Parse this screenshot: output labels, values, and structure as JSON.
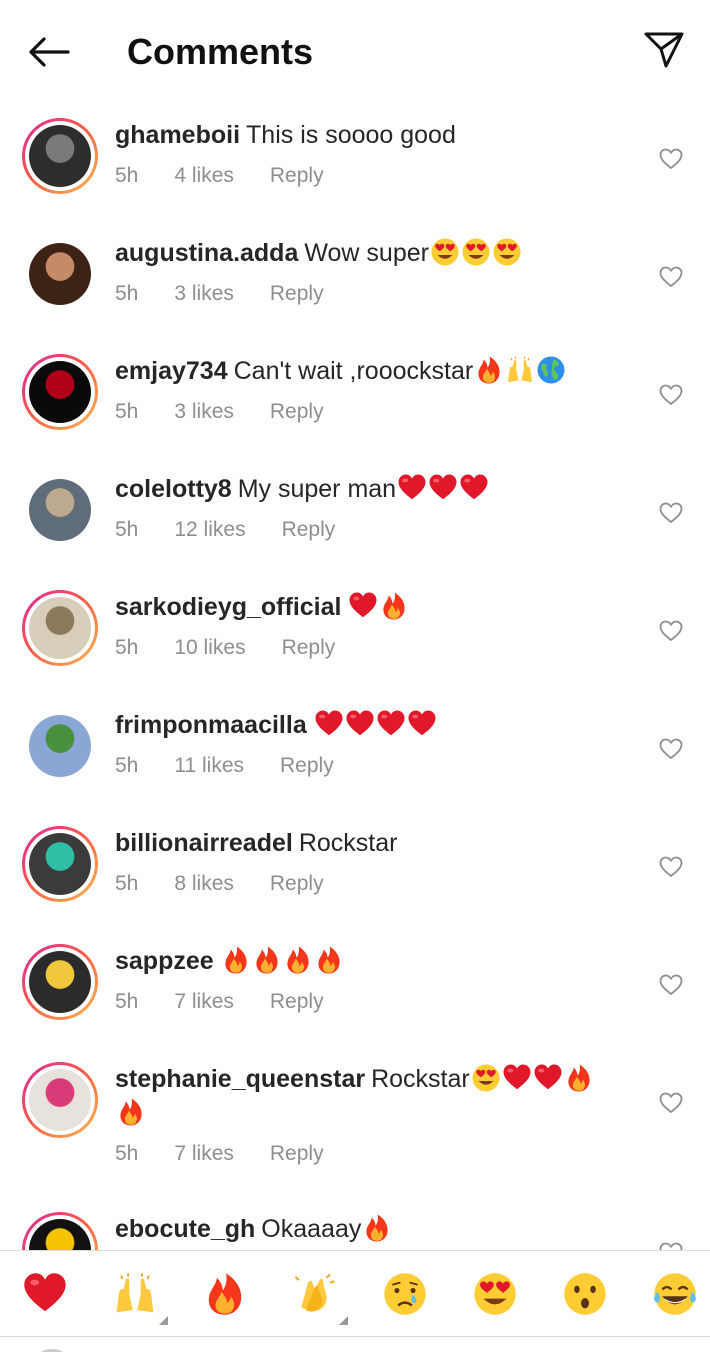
{
  "header": {
    "title": "Comments",
    "back_icon": "arrow-left-icon",
    "send_icon": "paper-plane-icon"
  },
  "colors": {
    "story_ring_start": "#d6249f",
    "story_ring_end": "#fdbb4f",
    "meta_gray": "#8e8e8e",
    "text": "#262626"
  },
  "comments": [
    {
      "username": "ghameboii",
      "text": "This is soooo good",
      "emojis": [],
      "time": "5h",
      "likes": "4 likes",
      "reply": "Reply",
      "story_ring": true
    },
    {
      "username": "augustina.adda",
      "text": "Wow super",
      "emojis": [
        "heart-eyes",
        "heart-eyes",
        "heart-eyes"
      ],
      "time": "5h",
      "likes": "3 likes",
      "reply": "Reply",
      "story_ring": false
    },
    {
      "username": "emjay734",
      "text": "Can't wait ,rooockstar",
      "emojis": [
        "fire",
        "raising-hands",
        "globe"
      ],
      "time": "5h",
      "likes": "3 likes",
      "reply": "Reply",
      "story_ring": true
    },
    {
      "username": "colelotty8",
      "text": "My super man",
      "emojis": [
        "red-heart",
        "red-heart",
        "red-heart"
      ],
      "time": "5h",
      "likes": "12 likes",
      "reply": "Reply",
      "story_ring": false
    },
    {
      "username": "sarkodieyg_official",
      "text": "",
      "emojis": [
        "red-heart",
        "fire"
      ],
      "time": "5h",
      "likes": "10 likes",
      "reply": "Reply",
      "story_ring": true
    },
    {
      "username": "frimponmaacilla",
      "text": "",
      "emojis": [
        "red-heart",
        "red-heart",
        "red-heart",
        "red-heart"
      ],
      "time": "5h",
      "likes": "11 likes",
      "reply": "Reply",
      "story_ring": false
    },
    {
      "username": "billionairreadel",
      "text": "Rockstar",
      "emojis": [],
      "time": "5h",
      "likes": "8 likes",
      "reply": "Reply",
      "story_ring": true
    },
    {
      "username": "sappzee",
      "text": "",
      "emojis": [
        "fire",
        "fire",
        "fire",
        "fire"
      ],
      "time": "5h",
      "likes": "7 likes",
      "reply": "Reply",
      "story_ring": true
    },
    {
      "username": "stephanie_queenstar",
      "text": "Rockstar",
      "emojis": [
        "heart-eyes",
        "red-heart",
        "red-heart",
        "fire",
        "fire"
      ],
      "time": "5h",
      "likes": "7 likes",
      "reply": "Reply",
      "story_ring": true
    },
    {
      "username": "ebocute_gh",
      "text": "Okaaaay",
      "emojis": [
        "fire"
      ],
      "time": "",
      "likes": "",
      "reply": "",
      "story_ring": true
    }
  ],
  "quick_reactions": [
    "red-heart",
    "raising-hands",
    "fire",
    "clapping-hands",
    "crying-face",
    "heart-eyes",
    "surprised-face",
    "tears-of-joy"
  ]
}
